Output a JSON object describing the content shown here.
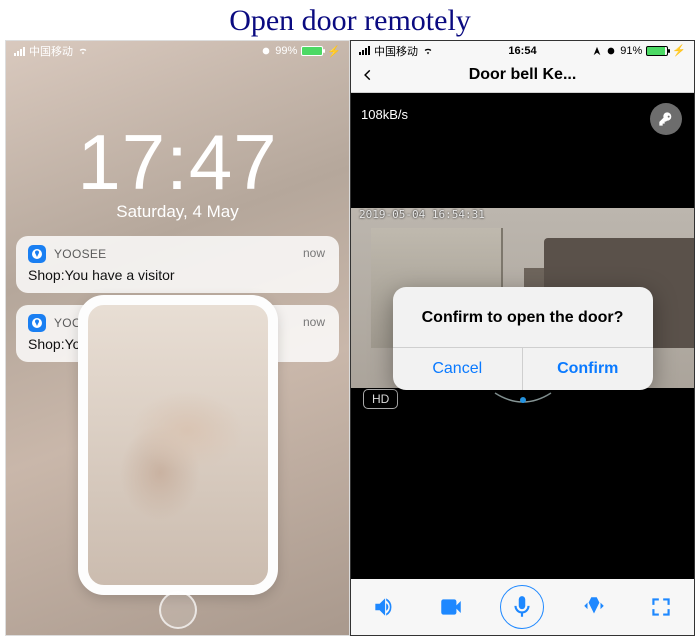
{
  "page_title": "Open door remotely",
  "left": {
    "status": {
      "carrier": "中国移动",
      "battery": "99%"
    },
    "clock": {
      "time": "17:47",
      "date": "Saturday, 4 May"
    },
    "notifications": [
      {
        "app": "YOOSEE",
        "time": "now",
        "body": "Shop:You have a visitor"
      },
      {
        "app": "YOOSEE",
        "time": "now",
        "body": "Shop:You have a visitor"
      }
    ]
  },
  "right": {
    "status": {
      "carrier": "中国移动",
      "clock": "16:54",
      "battery": "91%"
    },
    "nav_title": "Door bell Ke...",
    "bitrate": "108kB/s",
    "timestamp": "2019-05-04  16:54:31",
    "quality_badge": "HD",
    "alert": {
      "title": "Confirm to open the door?",
      "cancel": "Cancel",
      "confirm": "Confirm"
    }
  }
}
